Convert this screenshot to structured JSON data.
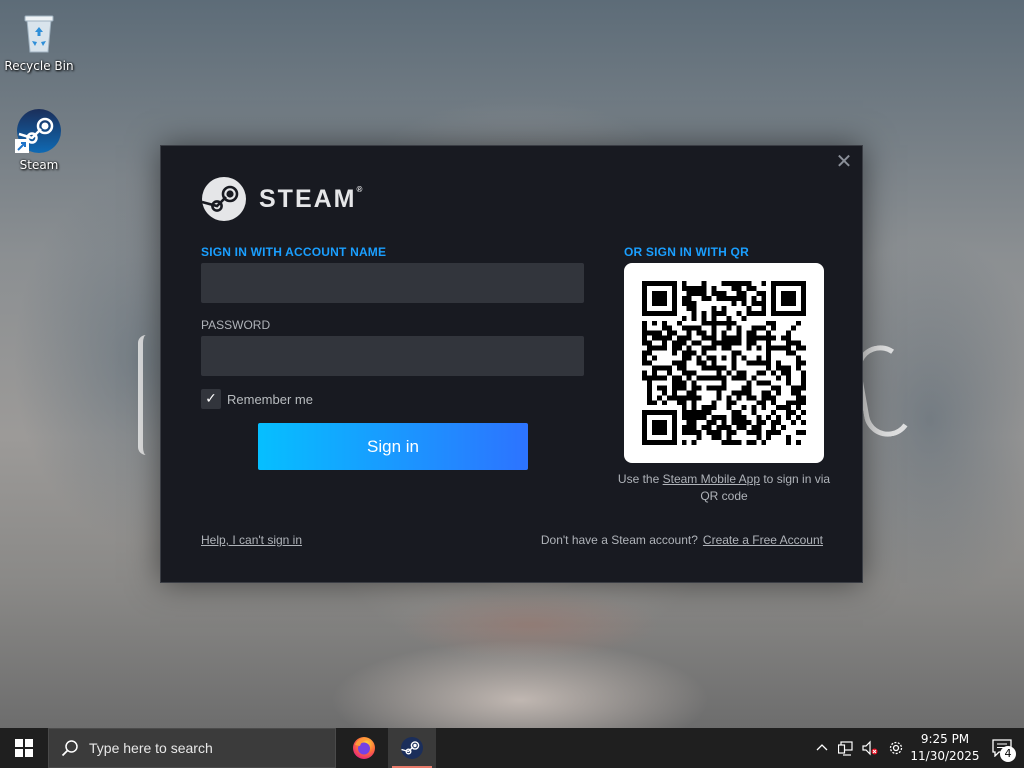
{
  "desktop": {
    "icons": [
      {
        "label": "Recycle Bin",
        "icon": "recycle-bin-icon"
      },
      {
        "label": "Steam",
        "icon": "steam-icon"
      }
    ]
  },
  "dialog": {
    "brand": "STEAM",
    "brand_mark": "®",
    "account_section_title": "SIGN IN WITH ACCOUNT NAME",
    "account_value": "",
    "password_label": "PASSWORD",
    "password_value": "",
    "remember_label": "Remember me",
    "remember_checked": true,
    "signin_label": "Sign in",
    "qr_section_title": "OR SIGN IN WITH QR",
    "qr_caption_prefix": "Use the ",
    "qr_caption_link": "Steam Mobile App",
    "qr_caption_suffix": " to sign in via QR code",
    "help_link": "Help, I can't sign in",
    "no_account_text": "Don't have a Steam account?",
    "create_account_link": "Create a Free Account",
    "close_glyph": "✕",
    "colors": {
      "accent": "#1a9fff",
      "button_start": "#06bfff",
      "button_end": "#2d73ff",
      "background": "#181a21"
    }
  },
  "taskbar": {
    "search_placeholder": "Type here to search",
    "apps": [
      {
        "name": "Firefox",
        "icon": "firefox-icon",
        "active": false
      },
      {
        "name": "Steam",
        "icon": "steam-icon",
        "active": true
      }
    ],
    "tray_icons": [
      "chevron-up-icon",
      "network-icon",
      "volume-muted-icon",
      "settings-icon"
    ],
    "time": "9:25 PM",
    "date": "11/30/2025",
    "notification_count": "4"
  }
}
